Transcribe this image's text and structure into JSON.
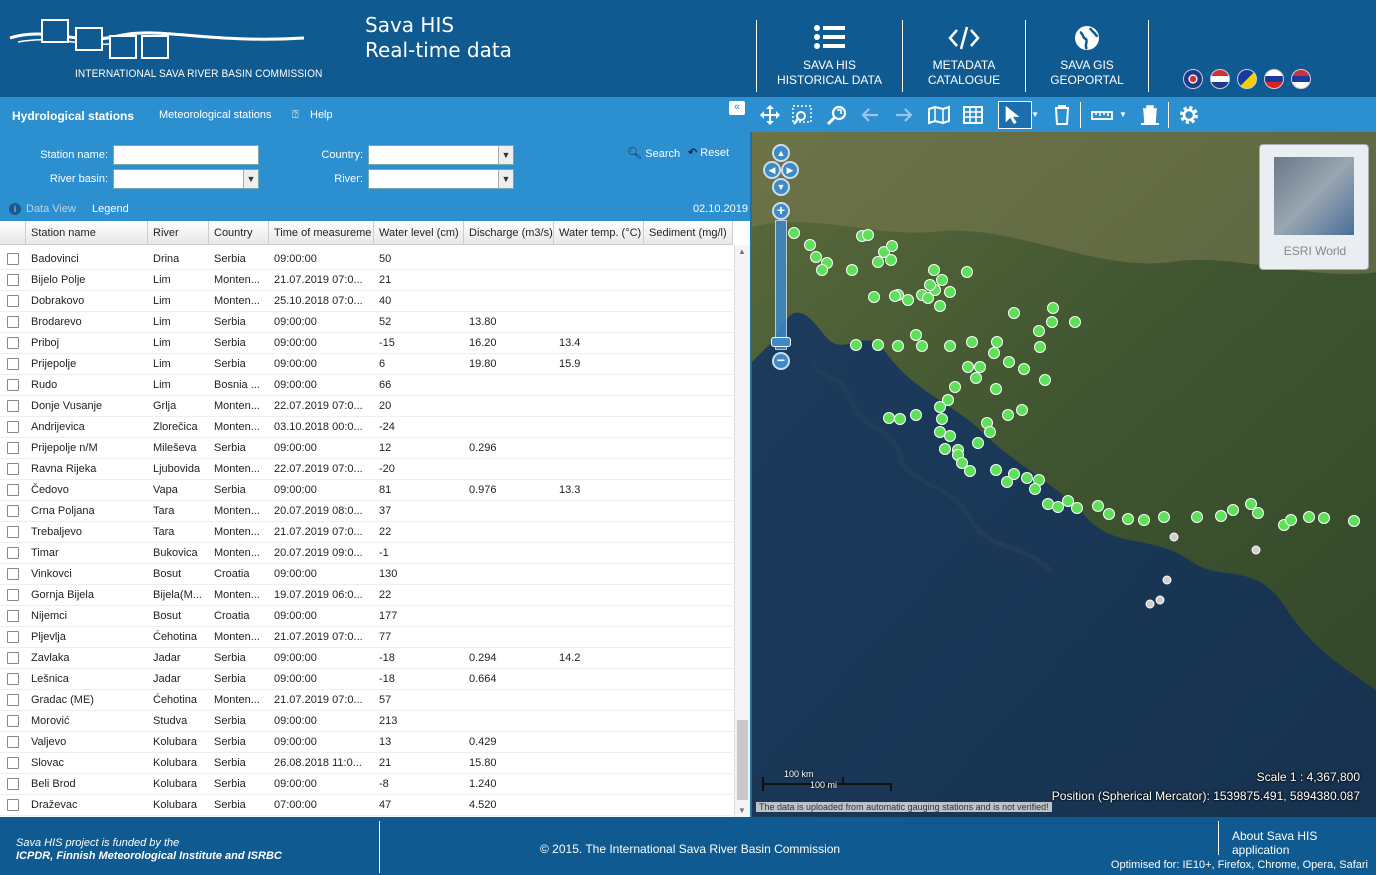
{
  "header": {
    "org_name": "INTERNATIONAL SAVA RIVER BASIN COMMISSION",
    "title_line1": "Sava HIS",
    "title_line2": "Real-time data",
    "nav": [
      {
        "line1": "SAVA HIS",
        "line2": "HISTORICAL DATA",
        "icon": "list-icon"
      },
      {
        "line1": "METADATA",
        "line2": "CATALOGUE",
        "icon": "code-icon"
      },
      {
        "line1": "SAVA GIS",
        "line2": "GEOPORTAL",
        "icon": "globe-icon"
      }
    ],
    "flags": [
      "english",
      "croatian",
      "bosnian",
      "slovenian",
      "serbian"
    ]
  },
  "tabs": {
    "hydro": "Hydrological stations",
    "meteo": "Meteorological stations",
    "help": "Help"
  },
  "filter": {
    "station_name_label": "Station name:",
    "river_basin_label": "River basin:",
    "country_label": "Country:",
    "river_label": "River:",
    "search": "Search",
    "reset": "Reset"
  },
  "dataview": {
    "data_view": "Data View",
    "legend": "Legend",
    "date": "02.10.2019"
  },
  "table": {
    "columns": [
      "Station name",
      "River",
      "Country",
      "Time of measureme",
      "Water level (cm)",
      "Discharge (m3/s)",
      "Water temp. (°C)",
      "Sediment (mg/l)"
    ],
    "rows": [
      [
        "Badovinci",
        "Drina",
        "Serbia",
        "09:00:00",
        "50",
        "",
        "",
        ""
      ],
      [
        "Bijelo Polje",
        "Lim",
        "Monten...",
        "21.07.2019 07:0...",
        "21",
        "",
        "",
        ""
      ],
      [
        "Dobrakovo",
        "Lim",
        "Monten...",
        "25.10.2018 07:0...",
        "40",
        "",
        "",
        ""
      ],
      [
        "Brodarevo",
        "Lim",
        "Serbia",
        "09:00:00",
        "52",
        "13.80",
        "",
        ""
      ],
      [
        "Priboj",
        "Lim",
        "Serbia",
        "09:00:00",
        "-15",
        "16.20",
        "13.4",
        ""
      ],
      [
        "Prijepolje",
        "Lim",
        "Serbia",
        "09:00:00",
        "6",
        "19.80",
        "15.9",
        ""
      ],
      [
        "Rudo",
        "Lim",
        "Bosnia ...",
        "09:00:00",
        "66",
        "",
        "",
        ""
      ],
      [
        "Donje Vusanje",
        "Grlja",
        "Monten...",
        "22.07.2019 07:0...",
        "20",
        "",
        "",
        ""
      ],
      [
        "Andrijevica",
        "Zlorečica",
        "Monten...",
        "03.10.2018 00:0...",
        "-24",
        "",
        "",
        ""
      ],
      [
        "Prijepolje n/M",
        "Mileševa",
        "Serbia",
        "09:00:00",
        "12",
        "0.296",
        "",
        ""
      ],
      [
        "Ravna Rijeka",
        "Ljubovida",
        "Monten...",
        "22.07.2019 07:0...",
        "-20",
        "",
        "",
        ""
      ],
      [
        "Čedovo",
        "Vapa",
        "Serbia",
        "09:00:00",
        "81",
        "0.976",
        "13.3",
        ""
      ],
      [
        "Crna Poljana",
        "Tara",
        "Monten...",
        "20.07.2019 08:0...",
        "37",
        "",
        "",
        ""
      ],
      [
        "Trebaljevo",
        "Tara",
        "Monten...",
        "21.07.2019 07:0...",
        "22",
        "",
        "",
        ""
      ],
      [
        "Timar",
        "Bukovica",
        "Monten...",
        "20.07.2019 09:0...",
        "-1",
        "",
        "",
        ""
      ],
      [
        "Vinkovci",
        "Bosut",
        "Croatia",
        "09:00:00",
        "130",
        "",
        "",
        ""
      ],
      [
        "Gornja Bijela",
        "Bijela(M...",
        "Monten...",
        "19.07.2019 06:0...",
        "22",
        "",
        "",
        ""
      ],
      [
        "Nijemci",
        "Bosut",
        "Croatia",
        "09:00:00",
        "177",
        "",
        "",
        ""
      ],
      [
        "Pljevlja",
        "Ćehotina",
        "Monten...",
        "21.07.2019 07:0...",
        "77",
        "",
        "",
        ""
      ],
      [
        "Zavlaka",
        "Jadar",
        "Serbia",
        "09:00:00",
        "-18",
        "0.294",
        "14.2",
        ""
      ],
      [
        "Lešnica",
        "Jadar",
        "Serbia",
        "09:00:00",
        "-18",
        "0.664",
        "",
        ""
      ],
      [
        "Gradac (ME)",
        "Ćehotina",
        "Monten...",
        "21.07.2019 07:0...",
        "57",
        "",
        "",
        ""
      ],
      [
        "Morović",
        "Studva",
        "Serbia",
        "09:00:00",
        "213",
        "",
        "",
        ""
      ],
      [
        "Valjevo",
        "Kolubara",
        "Serbia",
        "09:00:00",
        "13",
        "0.429",
        "",
        ""
      ],
      [
        "Slovac",
        "Kolubara",
        "Serbia",
        "26.08.2018 11:0...",
        "21",
        "15.80",
        "",
        ""
      ],
      [
        "Beli Brod",
        "Kolubara",
        "Serbia",
        "09:00:00",
        "-8",
        "1.240",
        "",
        ""
      ],
      [
        "Draževac",
        "Kolubara",
        "Serbia",
        "07:00:00",
        "47",
        "4.520",
        "",
        ""
      ]
    ]
  },
  "map": {
    "basemap_label": "ESRI World",
    "scale_km": "100 km",
    "scale_mi": "100 mi",
    "scale_text": "Scale 1 : 4,367,800",
    "position_text": "Position (Spherical Mercator):  1539875.491, 5894380.087",
    "notice": "The data is uploaded from automatic gauging stations and is not verified!",
    "colors": {
      "station_active": "#5ee05a",
      "station_inactive": "#cfcfcf"
    }
  },
  "footer": {
    "funded_line1": "Sava HIS project is funded by the",
    "funded_line2": "ICPDR, Finnish Meteorological Institute and ISRBC",
    "copyright": "© 2015. The International Sava River Basin Commission",
    "about": "About Sava HIS application",
    "optimised": "Optimised for: IE10+, Firefox, Chrome, Opera, Safari"
  }
}
